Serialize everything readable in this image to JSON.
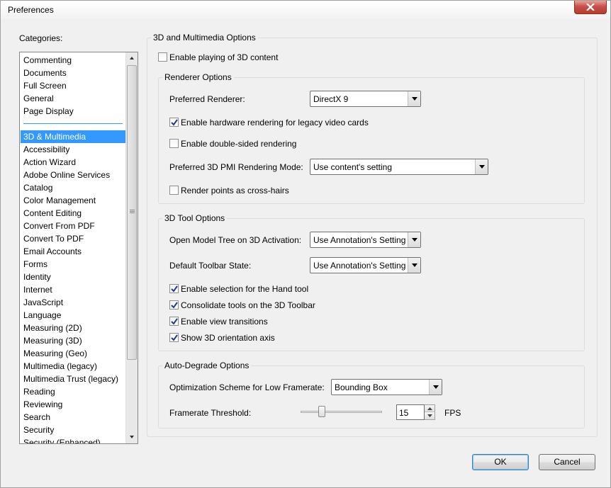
{
  "window": {
    "title": "Preferences"
  },
  "categories": {
    "label": "Categories:",
    "top_items": [
      "Commenting",
      "Documents",
      "Full Screen",
      "General",
      "Page Display"
    ],
    "items": [
      "3D & Multimedia",
      "Accessibility",
      "Action Wizard",
      "Adobe Online Services",
      "Catalog",
      "Color Management",
      "Content Editing",
      "Convert From PDF",
      "Convert To PDF",
      "Email Accounts",
      "Forms",
      "Identity",
      "Internet",
      "JavaScript",
      "Language",
      "Measuring (2D)",
      "Measuring (3D)",
      "Measuring (Geo)",
      "Multimedia (legacy)",
      "Multimedia Trust (legacy)",
      "Reading",
      "Reviewing",
      "Search",
      "Security",
      "Security (Enhanced)"
    ],
    "selected": "3D & Multimedia"
  },
  "panel": {
    "title": "3D and Multimedia Options",
    "enable_3d": {
      "label": "Enable playing of 3D content",
      "checked": false
    },
    "renderer": {
      "title": "Renderer Options",
      "preferred_renderer_label": "Preferred Renderer:",
      "preferred_renderer_value": "DirectX 9",
      "hw_legacy": {
        "label": "Enable hardware rendering for legacy video cards",
        "checked": true
      },
      "double_sided": {
        "label": "Enable double-sided rendering",
        "checked": false
      },
      "pmi_label": "Preferred 3D PMI Rendering Mode:",
      "pmi_value": "Use content's setting",
      "crosshairs": {
        "label": "Render points as cross-hairs",
        "checked": false
      }
    },
    "tool": {
      "title": "3D Tool Options",
      "model_tree_label": "Open Model Tree on 3D Activation:",
      "model_tree_value": "Use Annotation's Setting",
      "toolbar_state_label": "Default Toolbar State:",
      "toolbar_state_value": "Use Annotation's Setting",
      "hand_tool": {
        "label": "Enable selection for the Hand tool",
        "checked": true
      },
      "consolidate": {
        "label": "Consolidate tools on the 3D Toolbar",
        "checked": true
      },
      "transitions": {
        "label": "Enable view transitions",
        "checked": true
      },
      "orientation": {
        "label": "Show 3D orientation axis",
        "checked": true
      }
    },
    "degrade": {
      "title": "Auto-Degrade Options",
      "scheme_label": "Optimization Scheme for Low Framerate:",
      "scheme_value": "Bounding Box",
      "threshold_label": "Framerate Threshold:",
      "threshold_value": "15",
      "threshold_unit": "FPS"
    }
  },
  "buttons": {
    "ok": "OK",
    "cancel": "Cancel"
  }
}
